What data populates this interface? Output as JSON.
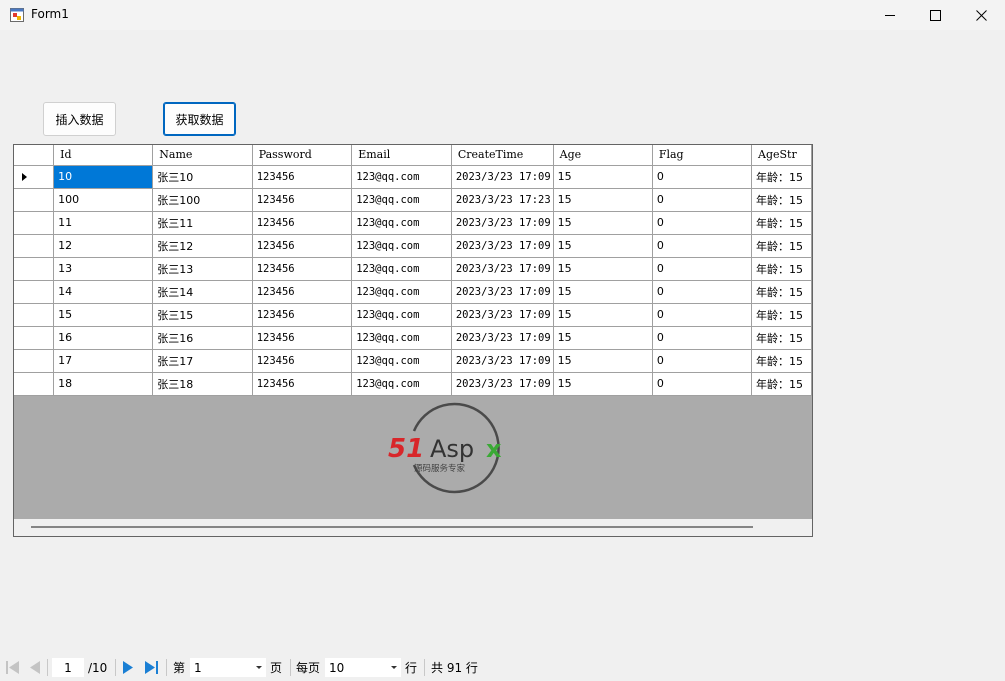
{
  "window": {
    "title": "Form1"
  },
  "buttons": {
    "insert": "插入数据",
    "fetch": "获取数据"
  },
  "grid": {
    "columns": [
      "Id",
      "Name",
      "Password",
      "Email",
      "CreateTime",
      "Age",
      "Flag",
      "AgeStr"
    ],
    "rows": [
      [
        "10",
        "张三10",
        "123456",
        "123@qq.com",
        "2023/3/23 17:09",
        "15",
        "0",
        "年龄：15"
      ],
      [
        "100",
        "张三100",
        "123456",
        "123@qq.com",
        "2023/3/23 17:23",
        "15",
        "0",
        "年龄：15"
      ],
      [
        "11",
        "张三11",
        "123456",
        "123@qq.com",
        "2023/3/23 17:09",
        "15",
        "0",
        "年龄：15"
      ],
      [
        "12",
        "张三12",
        "123456",
        "123@qq.com",
        "2023/3/23 17:09",
        "15",
        "0",
        "年龄：15"
      ],
      [
        "13",
        "张三13",
        "123456",
        "123@qq.com",
        "2023/3/23 17:09",
        "15",
        "0",
        "年龄：15"
      ],
      [
        "14",
        "张三14",
        "123456",
        "123@qq.com",
        "2023/3/23 17:09",
        "15",
        "0",
        "年龄：15"
      ],
      [
        "15",
        "张三15",
        "123456",
        "123@qq.com",
        "2023/3/23 17:09",
        "15",
        "0",
        "年龄：15"
      ],
      [
        "16",
        "张三16",
        "123456",
        "123@qq.com",
        "2023/3/23 17:09",
        "15",
        "0",
        "年龄：15"
      ],
      [
        "17",
        "张三17",
        "123456",
        "123@qq.com",
        "2023/3/23 17:09",
        "15",
        "0",
        "年龄：15"
      ],
      [
        "18",
        "张三18",
        "123456",
        "123@qq.com",
        "2023/3/23 17:09",
        "15",
        "0",
        "年龄：15"
      ]
    ],
    "selected_row": 0,
    "selected_color": "#0078d7"
  },
  "watermark": {
    "brand": "51Aspx",
    "tagline": "源码服务专家"
  },
  "pager": {
    "current_page": "1",
    "total_pages": "/10",
    "page_prefix": "第",
    "page_select_value": "1",
    "page_suffix": "页",
    "per_page_label": "每页",
    "per_page_value": "10",
    "per_page_suffix": "行",
    "total_text": "共 91 行",
    "accent": "#1a7fd4"
  }
}
